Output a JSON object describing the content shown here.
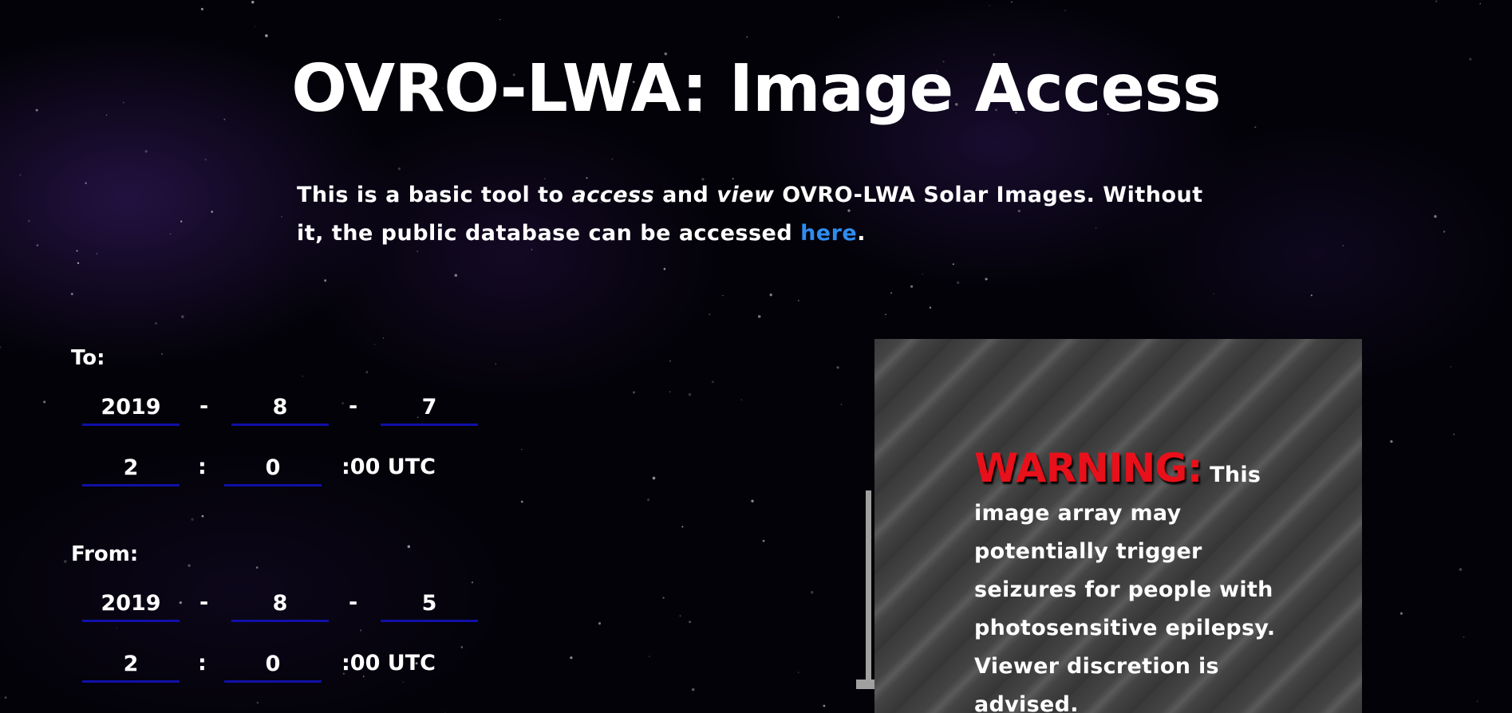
{
  "page": {
    "title": "OVRO-LWA: Image Access"
  },
  "intro": {
    "part1": "This is a basic tool to ",
    "em1": "access",
    "part2": " and ",
    "em2": "view",
    "part3": " OVRO-LWA Solar Images. Without it, the public database can be accessed ",
    "link_text": "here",
    "part4": "."
  },
  "to": {
    "label": "To:",
    "year": "2019",
    "month": "8",
    "day": "7",
    "hour": "2",
    "minute": "0"
  },
  "from": {
    "label": "From:",
    "year": "2019",
    "month": "8",
    "day": "5",
    "hour": "2",
    "minute": "0"
  },
  "separators": {
    "date": "-",
    "time": ":",
    "seconds_utc": ":00 UTC"
  },
  "warning": {
    "heading": "WARNING:",
    "body": " This image array may potentially trigger seizures for people with photosensitive epilepsy. Viewer discretion is advised."
  },
  "colors": {
    "background": "#030208",
    "link": "#2f8df0",
    "warning_heading": "#e8101a",
    "field_underline": "#1010a8"
  }
}
